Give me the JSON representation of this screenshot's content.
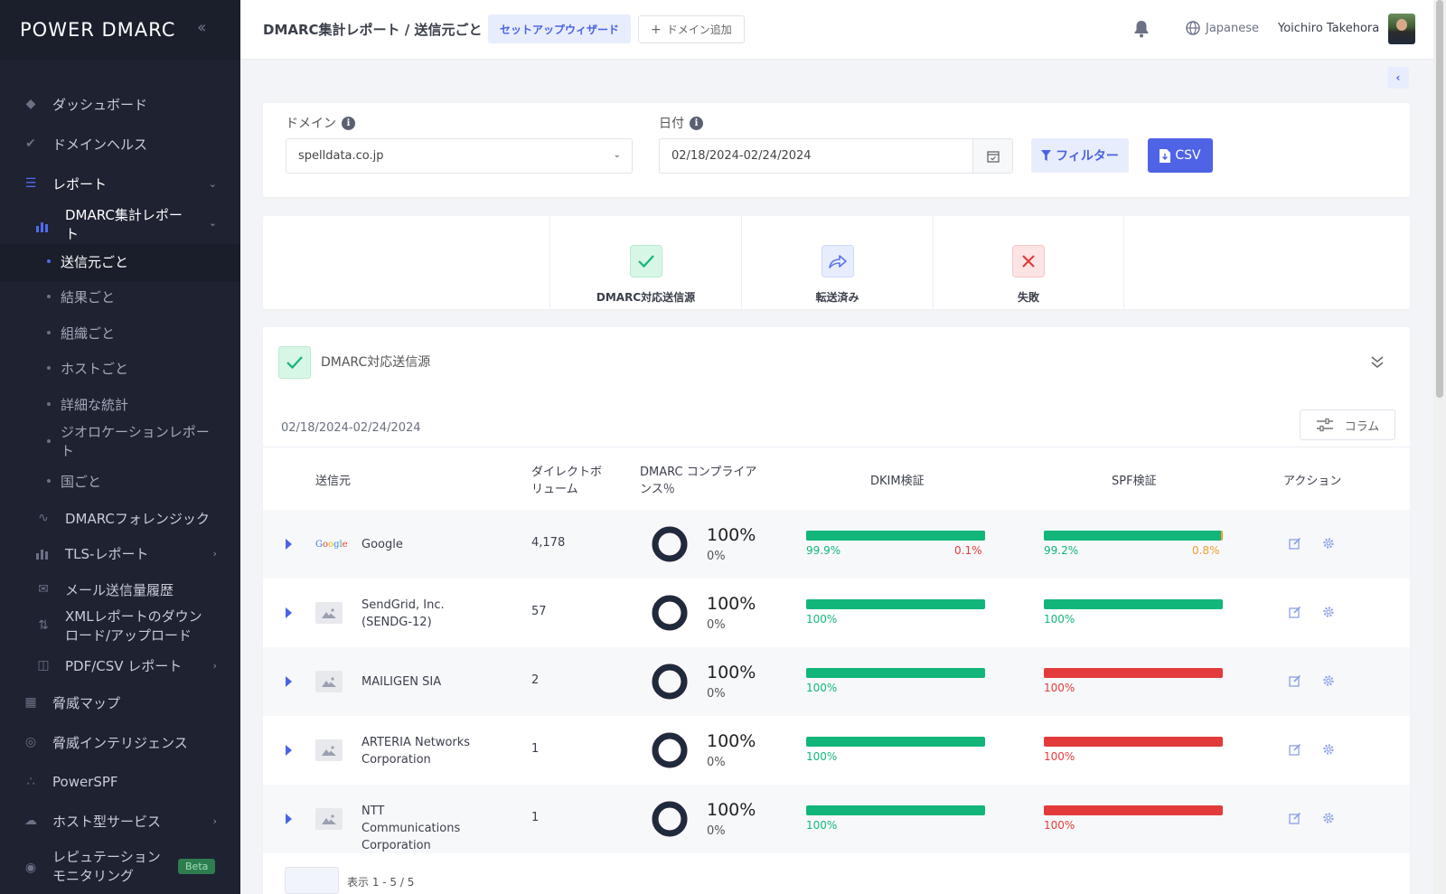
{
  "app": {
    "logo": "POWER DMARC"
  },
  "sidebar": {
    "items": [
      {
        "label": "ダッシュボード"
      },
      {
        "label": "ドメインヘルス"
      },
      {
        "label": "レポート"
      },
      {
        "label": "DMARC集計レポート"
      },
      {
        "label": "DMARCフォレンジック"
      },
      {
        "label": "TLS-レポート"
      },
      {
        "label": "メール送信量履歴"
      },
      {
        "label": "XMLレポートのダウンロード/アップロード"
      },
      {
        "label": "PDF/CSV レポート"
      },
      {
        "label": "脅威マップ"
      },
      {
        "label": "脅威インテリジェンス"
      },
      {
        "label": "PowerSPF"
      },
      {
        "label": "ホスト型サービス"
      },
      {
        "label": "レピュテーションモニタリング"
      }
    ],
    "subitems": [
      {
        "label": "送信元ごと"
      },
      {
        "label": "結果ごと"
      },
      {
        "label": "組織ごと"
      },
      {
        "label": "ホストごと"
      },
      {
        "label": "詳細な統計"
      },
      {
        "label": "ジオロケーションレポート"
      },
      {
        "label": "国ごと"
      }
    ],
    "beta": "Beta"
  },
  "header": {
    "breadcrumb": "DMARC集計レポート / 送信元ごと",
    "wizard": "セットアップウィザード",
    "add_domain": "ドメイン追加",
    "language": "Japanese",
    "user": "Yoichiro Takehora"
  },
  "filters": {
    "domain_label": "ドメイン",
    "domain_value": "spelldata.co.jp",
    "date_label": "日付",
    "date_value": "02/18/2024-02/24/2024",
    "filter_button": "フィルター",
    "csv_button": "CSV"
  },
  "tabs": [
    {
      "label": "DMARC対応送信源"
    },
    {
      "label": "転送済み"
    },
    {
      "label": "失敗"
    }
  ],
  "section": {
    "title": "DMARC対応送信源",
    "date_range": "02/18/2024-02/24/2024",
    "columns_button": "コラム"
  },
  "table": {
    "headers": [
      "送信元",
      "ダイレクトボリューム",
      "DMARC コンプライアンス％",
      "DKIM検証",
      "SPF検証",
      "アクション"
    ],
    "rows": [
      {
        "sender": "Google",
        "volume": "4,178",
        "compliance": "100%",
        "noncompliance": "0%",
        "compliance_value": 100,
        "dkim_pass": "99.9%",
        "dkim_fail": "0.1%",
        "dkim_value": 99.9,
        "spf_pass": "99.2%",
        "spf_fail": "0.8%",
        "spf_value": 99.2
      },
      {
        "sender": "SendGrid, Inc. (SENDG-12)",
        "volume": "57",
        "compliance": "100%",
        "noncompliance": "0%",
        "compliance_value": 100,
        "dkim_pass": "100%",
        "dkim_fail": "",
        "dkim_value": 100,
        "spf_pass": "100%",
        "spf_fail": "",
        "spf_value": 100
      },
      {
        "sender": "MAILIGEN SIA",
        "volume": "2",
        "compliance": "100%",
        "noncompliance": "0%",
        "compliance_value": 100,
        "dkim_pass": "100%",
        "dkim_fail": "",
        "dkim_value": 100,
        "spf_pass": "",
        "spf_fail": "100%",
        "spf_value": 0
      },
      {
        "sender": "ARTERIA Networks Corporation",
        "volume": "1",
        "compliance": "100%",
        "noncompliance": "0%",
        "compliance_value": 100,
        "dkim_pass": "100%",
        "dkim_fail": "",
        "dkim_value": 100,
        "spf_pass": "",
        "spf_fail": "100%",
        "spf_value": 0
      },
      {
        "sender": "NTT Communications Corporation",
        "volume": "1",
        "compliance": "100%",
        "noncompliance": "0%",
        "compliance_value": 100,
        "dkim_pass": "100%",
        "dkim_fail": "",
        "dkim_value": 100,
        "spf_pass": "",
        "spf_fail": "100%",
        "spf_value": 0
      }
    ]
  },
  "pagination": {
    "text": "表示 1 - 5 / 5"
  },
  "colors": {
    "accent": "#4f63e7",
    "pass": "#12b67a",
    "fail": "#e33b3b",
    "warn": "#f0a030",
    "sidebar": "#1e2231"
  }
}
